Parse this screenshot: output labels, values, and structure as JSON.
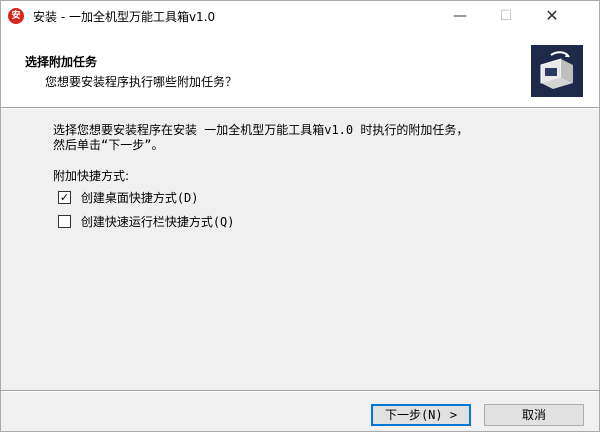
{
  "window": {
    "title": "安装 - 一加全机型万能工具箱v1.0",
    "app_icon_text": "安",
    "controls": {
      "minimize": "—",
      "maximize": "☐",
      "close": "✕"
    }
  },
  "header": {
    "title": "选择附加任务",
    "subtitle": "您想要安装程序执行哪些附加任务？",
    "image_icon": "computer-installer-icon"
  },
  "body": {
    "instruction_line1": "选择您想要安装程序在安装 一加全机型万能工具箱v1.0 时执行的附加任务，",
    "instruction_line2": "然后单击“下一步”。",
    "group_label": "附加快捷方式:",
    "options": [
      {
        "label": "创建桌面快捷方式(D)",
        "checked": true,
        "mark": "✓"
      },
      {
        "label": "创建快速运行栏快捷方式(Q)",
        "checked": false,
        "mark": ""
      }
    ]
  },
  "footer": {
    "next_label": "下一步(N) >",
    "cancel_label": "取消"
  },
  "colors": {
    "accent": "#0078d7",
    "header_bg": "#ffffff",
    "body_bg": "#f0f0f0",
    "app_icon": "#d8261f"
  }
}
